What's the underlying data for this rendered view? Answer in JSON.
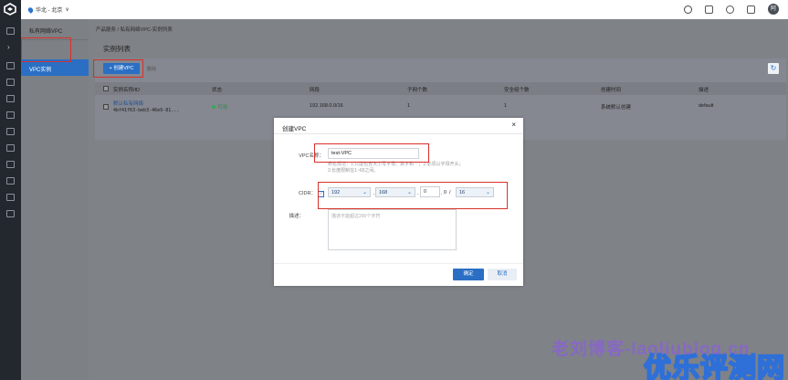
{
  "topbar": {
    "region": "华北 - 北京",
    "avatar_initial": "阿"
  },
  "sidebar": {
    "section_title": "私有网络VPC",
    "active_item": "VPC实例"
  },
  "breadcrumb": "产品服务  /  私有网络VPC-实例列表",
  "page_title": "实例列表",
  "toolbar": {
    "create_label": "+ 创建VPC",
    "delete_label": "删除"
  },
  "table": {
    "columns": [
      "实例名称/ID",
      "状态",
      "网段",
      "子网个数",
      "安全组个数",
      "创建时间",
      "描述"
    ],
    "rows": [
      {
        "name": "默认私有网络",
        "id": "4bf41f63-beb3-46e9-81...",
        "status": "可用",
        "cidr": "192.168.0.0/16",
        "subnets": "1",
        "security_groups": "1",
        "created": "系统默认创建",
        "description": "default"
      }
    ]
  },
  "modal": {
    "title": "创建VPC",
    "close": "×",
    "name_label": "VPC名称：",
    "name_value": "test-VPC",
    "name_hint": "命名规范：1.只能包含大小写字母、数字和\"-\"；2.必须以字母开头；3.长度限制在1~65之间。",
    "cidr_label": "CIDR：",
    "cidr_help": "?",
    "cidr_octet1": "192",
    "cidr_octet2": "168",
    "cidr_octet3": "0",
    "cidr_octet4": "0",
    "cidr_mask": "16",
    "desc_label": "描述：",
    "desc_placeholder": "描述不能超过200个字符",
    "ok_label": "确定",
    "cancel_label": "取消"
  },
  "watermark": {
    "line1": "老刘博客-laoliublog.cn",
    "line2": "优乐评测网"
  }
}
